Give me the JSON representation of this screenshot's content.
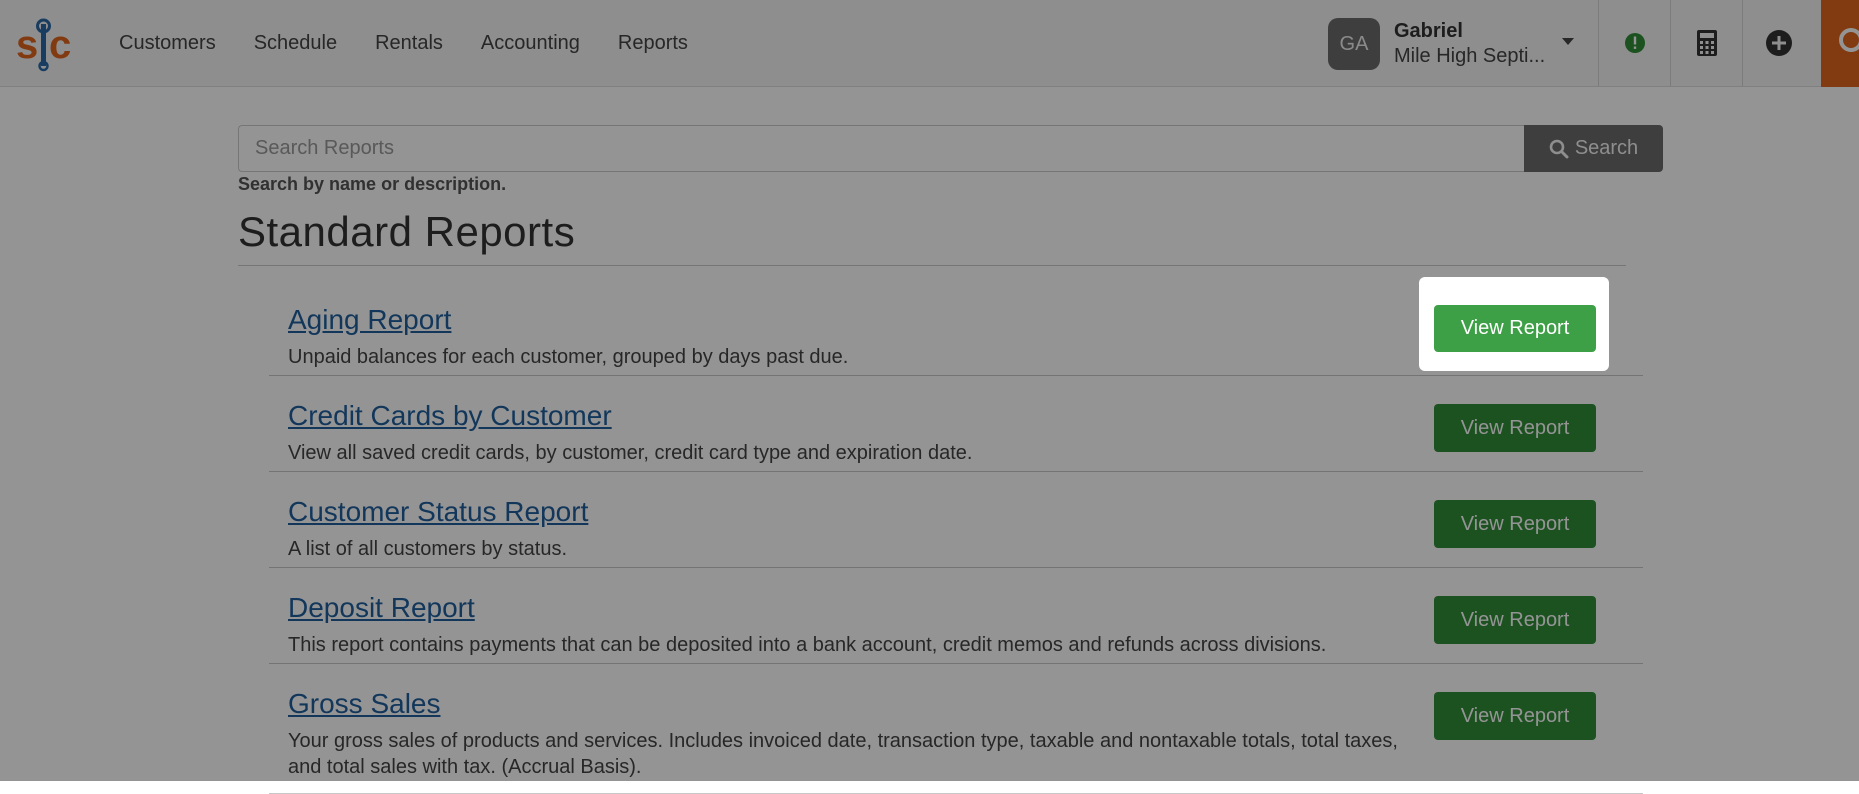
{
  "app": {
    "logo_text": "s|c"
  },
  "nav": {
    "items": [
      "Customers",
      "Schedule",
      "Rentals",
      "Accounting",
      "Reports"
    ]
  },
  "user": {
    "initials": "GA",
    "name": "Gabriel",
    "company": "Mile High Septi..."
  },
  "toolbar": {
    "icons": [
      "alert-icon",
      "calculator-icon",
      "plus-icon",
      "search-icon"
    ]
  },
  "search": {
    "placeholder": "Search Reports",
    "button_label": "Search",
    "help": "Search by name or description."
  },
  "section": {
    "title": "Standard Reports"
  },
  "reports": [
    {
      "title": "Aging Report",
      "description": "Unpaid balances for each customer, grouped by days past due.",
      "button": "View Report"
    },
    {
      "title": "Credit Cards by Customer",
      "description": "View all saved credit cards, by customer, credit card type and expiration date.",
      "button": "View Report"
    },
    {
      "title": "Customer Status Report",
      "description": "A list of all customers by status.",
      "button": "View Report"
    },
    {
      "title": "Deposit Report",
      "description": "This report contains payments that can be deposited into a bank account, credit memos and refunds across divisions.",
      "button": "View Report"
    },
    {
      "title": "Gross Sales",
      "description": "Your gross sales of products and services. Includes invoiced date, transaction type, taxable and nontaxable totals, total taxes, and total sales with tax. (Accrual Basis).",
      "button": "View Report"
    }
  ],
  "colors": {
    "accent": "#e0641c",
    "button_green": "#2f8e37",
    "link_blue": "#1f5f9e",
    "logo_orange": "#e0641c",
    "logo_blue": "#2b6aa8"
  }
}
